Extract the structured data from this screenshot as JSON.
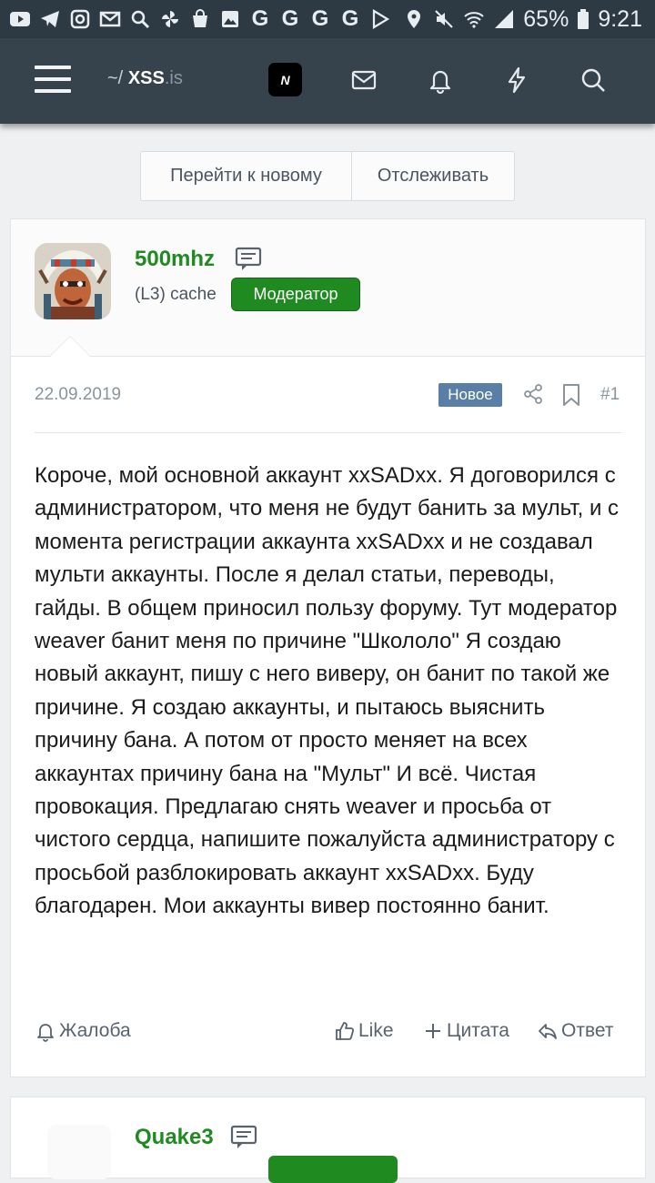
{
  "status_bar": {
    "battery": "65%",
    "time": "9:21",
    "left_icons": [
      "youtube-icon",
      "telegram-icon",
      "instagram-icon",
      "mail-icon",
      "search-icon",
      "pinwheel-icon",
      "bag-icon",
      "gallery-icon"
    ],
    "g_letters": [
      "G",
      "G",
      "G",
      "G"
    ]
  },
  "header": {
    "brand_prefix": "~/",
    "brand_name": "XSS",
    "brand_tld": ".is",
    "n_label": "N"
  },
  "top_buttons": {
    "go_to_new": "Перейти к новому",
    "watch": "Отслеживать"
  },
  "post": {
    "author": "500mhz",
    "user_title": "(L3) cache",
    "role_badge": "Модератор",
    "date": "22.09.2019",
    "new_badge": "Новое",
    "number": "#1",
    "body": "Короче, мой основной аккаунт xxSADxx. Я договорился с администратором, что меня не будут банить за мульт, и с момента регистрации аккаунта xxSADxx и не создавал мульти аккаунты. После я делал статьи, переводы, гайды. В общем приносил пользу форуму. Тут модератор weaver банит меня по причине \"Школоло\" Я создаю новый аккаунт, пишу с него виверу, он банит по такой же причине. Я создаю аккаунты, и пытаюсь выяснить причину бана. А потом от просто меняет на всех аккаунтах причину бана на \"Мульт\" И всё. Чистая провокация. Предлагаю снять weaver и просьба от чистого сердца, напишите пожалуйста администратору с просьбой разблокировать аккаунт xxSADxx. Буду благодарен. Мои аккаунты вивер постоянно банит.",
    "actions": {
      "report": "Жалоба",
      "like": "Like",
      "quote": "Цитата",
      "reply": "Ответ"
    }
  },
  "next_post": {
    "author": "Quake3"
  },
  "colors": {
    "accent_green": "#1f8a20",
    "header_bg": "#36434d",
    "new_badge_bg": "#5a7fa6"
  }
}
